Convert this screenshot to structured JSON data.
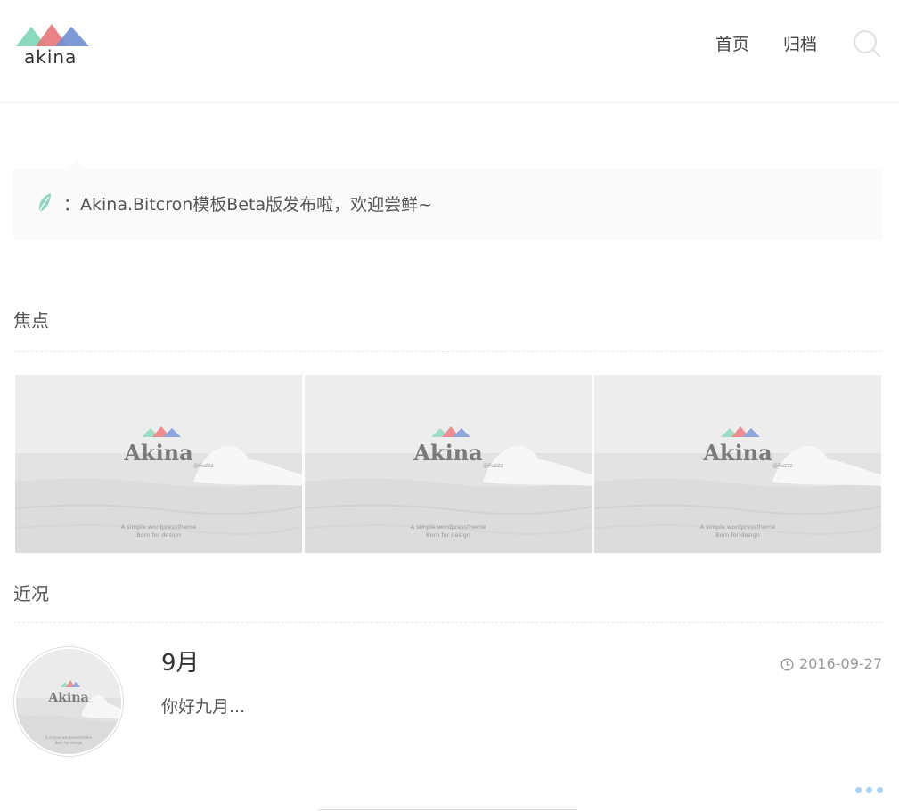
{
  "header": {
    "logo_text": "akina",
    "nav": [
      {
        "label": "首页"
      },
      {
        "label": "归档"
      }
    ],
    "icons": {
      "search": "search-icon"
    }
  },
  "notice": {
    "icon": "feather-icon",
    "text": "：Akina.Bitcron模板Beta版发布啦，欢迎尝鲜~"
  },
  "sections": {
    "focus_title": "焦点",
    "recent_title": "近况"
  },
  "focus": {
    "cards": [
      {
        "title": "Akina",
        "handle": "@Fuzzz",
        "line1": "A simple wordpresstheme",
        "line2": "Born for design"
      },
      {
        "title": "Akina",
        "handle": "@Fuzzz",
        "line1": "A simple wordpresstheme",
        "line2": "Born for design"
      },
      {
        "title": "Akina",
        "handle": "@Fuzzz",
        "line1": "A simple wordpresstheme",
        "line2": "Born for design"
      }
    ]
  },
  "post": {
    "title": "9月",
    "date": "2016-09-27",
    "date_icon": "clock-icon",
    "excerpt": "你好九月...",
    "thumb": {
      "title": "Akina",
      "line1": "A simple wordpresstheme",
      "line2": "Born for design"
    }
  },
  "colors": {
    "mint": "#7fd6b6",
    "coral": "#e8767a",
    "blue": "#6f8fd2",
    "dots": "#a5d2f0"
  }
}
